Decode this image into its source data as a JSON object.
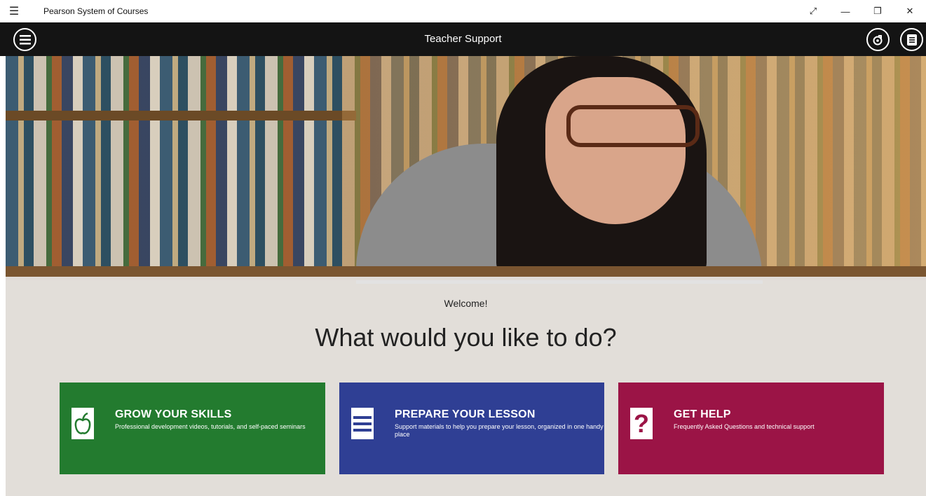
{
  "window": {
    "app_title": "Pearson System of Courses",
    "menu_icon": "hamburger-icon",
    "controls": [
      "expand-icon",
      "minimize-icon",
      "restore-icon",
      "close-icon"
    ]
  },
  "header": {
    "title": "Teacher Support",
    "left_icon": "menu-circle-icon",
    "right_icons": [
      "scope-circle-icon",
      "notes-circle-icon"
    ]
  },
  "main": {
    "welcome": "Welcome!",
    "headline": "What would you like to do?",
    "tiles": [
      {
        "title": "GROW YOUR SKILLS",
        "description": "Professional development videos, tutorials, and self-paced seminars",
        "icon": "apple-icon",
        "color": "#237b2f"
      },
      {
        "title": "PREPARE YOUR LESSON",
        "description": "Support materials to help you prepare your lesson, organized in one handy place",
        "icon": "lines-icon",
        "color": "#2f3f94"
      },
      {
        "title": "GET HELP",
        "description": "Frequently Asked Questions and technical support",
        "icon": "question-icon",
        "color": "#9b1446"
      }
    ]
  }
}
